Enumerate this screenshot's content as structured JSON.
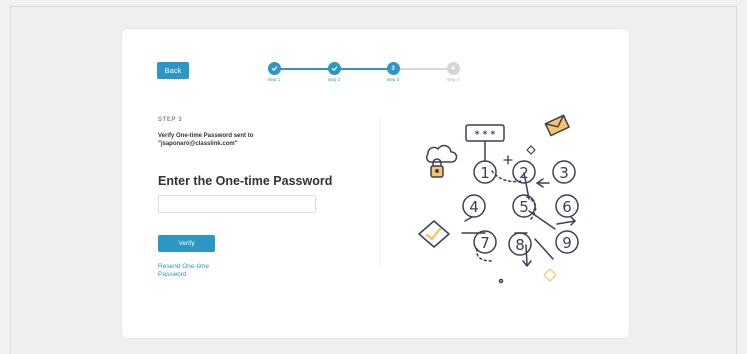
{
  "header": {
    "back_label": "Back"
  },
  "stepper": {
    "steps": [
      {
        "label": "step 1",
        "state": "done",
        "icon": "check-icon"
      },
      {
        "label": "step 2",
        "state": "done",
        "icon": "check-icon"
      },
      {
        "label": "step 3",
        "state": "current",
        "number": "3"
      },
      {
        "label": "step 4",
        "state": "todo",
        "number": "4"
      }
    ]
  },
  "form": {
    "step_label": "STEP 3",
    "instruction": "Verify One-time Password sent to \"jsaponaro@classlink.com\"",
    "heading": "Enter the One-time Password",
    "otp_value": "",
    "otp_placeholder": "",
    "verify_label": "Verify",
    "resend_label": "Resend One-time Password"
  },
  "illustration": {
    "icon": "password-keypad-illustration",
    "password_mask": "* * *",
    "keypad_digits": [
      "1",
      "2",
      "3",
      "4",
      "5",
      "6",
      "7",
      "8",
      "9"
    ]
  },
  "colors": {
    "accent": "#2c97c5",
    "background": "#f1f1f1",
    "card": "#ffffff",
    "illustration_yellow": "#f6c46a"
  }
}
